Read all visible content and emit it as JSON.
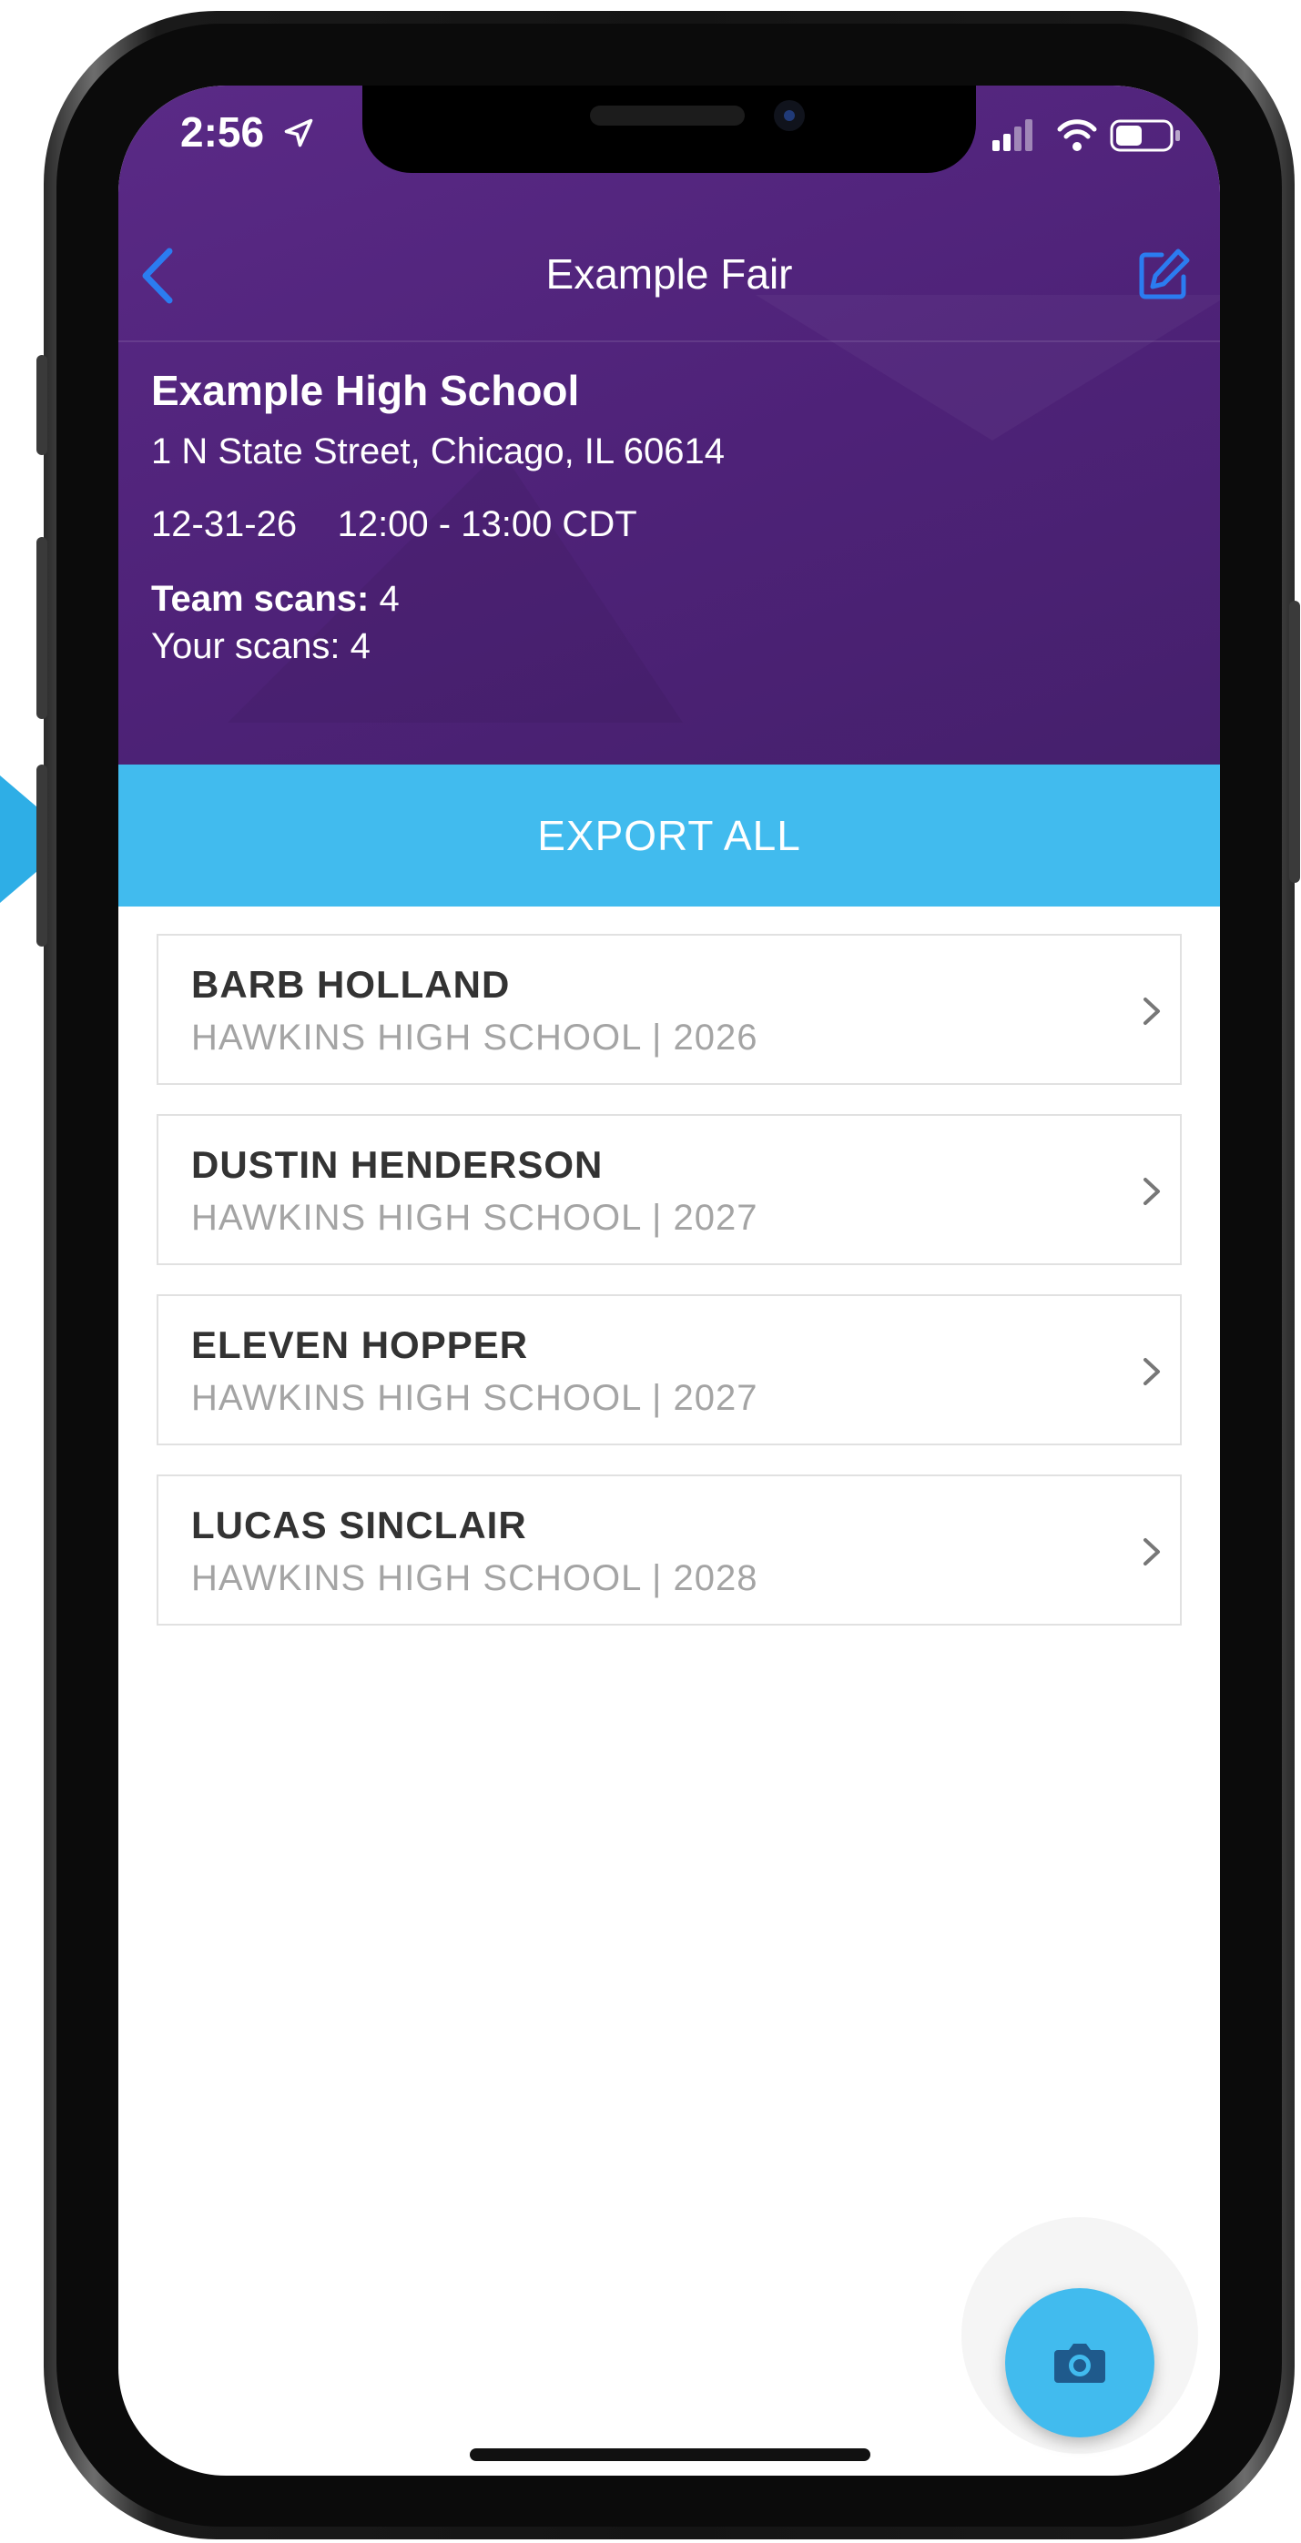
{
  "status_bar": {
    "time": "2:56"
  },
  "nav": {
    "title": "Example Fair"
  },
  "event": {
    "school": "Example High School",
    "address": "1 N State Street, Chicago, IL 60614",
    "date": "12-31-26",
    "time_range": "12:00 - 13:00 CDT",
    "team_scans_label": "Team scans:",
    "team_scans_value": "4",
    "your_scans_label": "Your scans:",
    "your_scans_value": "4"
  },
  "export_label": "EXPORT ALL",
  "students": [
    {
      "name": "BARB HOLLAND",
      "detail": "HAWKINS HIGH SCHOOL | 2026"
    },
    {
      "name": "DUSTIN HENDERSON",
      "detail": "HAWKINS HIGH SCHOOL | 2027"
    },
    {
      "name": "ELEVEN HOPPER",
      "detail": "HAWKINS HIGH SCHOOL | 2027"
    },
    {
      "name": "LUCAS SINCLAIR",
      "detail": "HAWKINS HIGH SCHOOL | 2028"
    }
  ],
  "colors": {
    "header_purple": "#4e2278",
    "accent_blue": "#41bbee",
    "ios_blue": "#2b7cf0"
  },
  "icons": {
    "back": "chevron-left-icon",
    "edit": "edit-icon",
    "camera": "camera-icon",
    "location": "location-arrow-icon",
    "chevron": "chevron-right-icon"
  }
}
